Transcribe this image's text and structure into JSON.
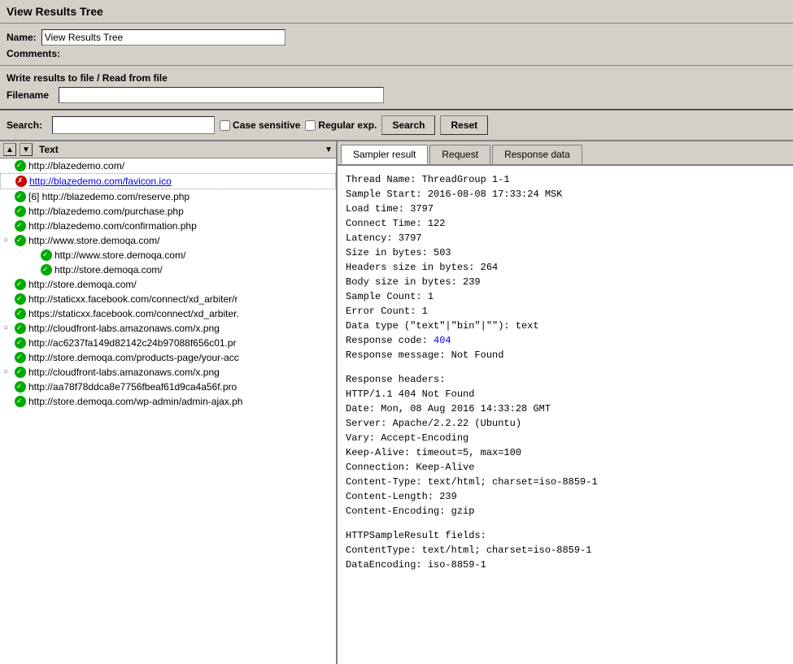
{
  "window": {
    "title": "View Results Tree"
  },
  "name_row": {
    "label": "Name:",
    "value": "View Results Tree"
  },
  "comments_row": {
    "label": "Comments:"
  },
  "write_section": {
    "header": "Write results to file / Read from file",
    "filename_label": "Filename"
  },
  "search": {
    "label": "Search:",
    "placeholder": "",
    "case_sensitive_label": "Case sensitive",
    "regular_exp_label": "Regular exp.",
    "search_button": "Search",
    "reset_button": "Reset"
  },
  "left_panel": {
    "column_header": "Text"
  },
  "tabs": {
    "sampler_result": "Sampler result",
    "request": "Request",
    "response_data": "Response data"
  },
  "tree_items": [
    {
      "id": 1,
      "indent": 0,
      "icon": "green",
      "url": "http://blazedemo.com/",
      "has_expand": false
    },
    {
      "id": 2,
      "indent": 0,
      "icon": "red",
      "url": "http://blazedemo.com/favicon.ico",
      "has_expand": false,
      "selected": true,
      "error": true
    },
    {
      "id": 3,
      "indent": 0,
      "icon": "green",
      "url": "[6] http://blazedemo.com/reserve.php",
      "has_expand": false
    },
    {
      "id": 4,
      "indent": 0,
      "icon": "green",
      "url": "http://blazedemo.com/purchase.php",
      "has_expand": false
    },
    {
      "id": 5,
      "indent": 0,
      "icon": "green",
      "url": "http://blazedemo.com/confirmation.php",
      "has_expand": false
    },
    {
      "id": 6,
      "indent": 0,
      "icon": "green",
      "url": "http://www.store.demoqa.com/",
      "has_expand": true,
      "expanded": true
    },
    {
      "id": 7,
      "indent": 1,
      "icon": "green",
      "url": "http://www.store.demoqa.com/",
      "has_expand": false
    },
    {
      "id": 8,
      "indent": 1,
      "icon": "green",
      "url": "http://store.demoqa.com/",
      "has_expand": false
    },
    {
      "id": 9,
      "indent": 0,
      "icon": "green",
      "url": "http://store.demoqa.com/",
      "has_expand": false
    },
    {
      "id": 10,
      "indent": 0,
      "icon": "green",
      "url": "http://staticxx.facebook.com/connect/xd_arbiter/r",
      "has_expand": false
    },
    {
      "id": 11,
      "indent": 0,
      "icon": "green",
      "url": "https://staticxx.facebook.com/connect/xd_arbiter.",
      "has_expand": false
    },
    {
      "id": 12,
      "indent": 0,
      "icon": "green",
      "url": "http://cloudfront-labs.amazonaws.com/x.png",
      "has_expand": true,
      "expanded": false
    },
    {
      "id": 13,
      "indent": 0,
      "icon": "green",
      "url": "http://ac6237fa149d82142c24b97088f656c01.pr",
      "has_expand": false
    },
    {
      "id": 14,
      "indent": 0,
      "icon": "green",
      "url": "http://store.demoqa.com/products-page/your-acc",
      "has_expand": false
    },
    {
      "id": 15,
      "indent": 0,
      "icon": "green",
      "url": "http://cloudfront-labs.amazonaws.com/x.png",
      "has_expand": true,
      "expanded": false
    },
    {
      "id": 16,
      "indent": 0,
      "icon": "green",
      "url": "http://aa78f78ddca8e7756fbeaf61d9ca4a56f.pro",
      "has_expand": false
    },
    {
      "id": 17,
      "indent": 0,
      "icon": "green",
      "url": "http://store.demoqa.com/wp-admin/admin-ajax.ph",
      "has_expand": false
    }
  ],
  "sampler_result": {
    "thread_name": "Thread Name: ThreadGroup 1-1",
    "sample_start": "Sample Start: 2016-08-08 17:33:24 MSK",
    "load_time": "Load time: 3797",
    "connect_time": "Connect Time: 122",
    "latency": "Latency: 3797",
    "size_bytes": "Size in bytes: 503",
    "headers_size": "Headers size in bytes: 264",
    "body_size": "Body size in bytes: 239",
    "sample_count": "Sample Count: 1",
    "error_count": "Error Count: 1",
    "data_type": "Data type (\"text\"|\"bin\"|\"\"): text",
    "response_code_prefix": "Response code: ",
    "response_code_value": "404",
    "response_message": "Response message: Not Found",
    "response_headers_label": "Response headers:",
    "http_status": "HTTP/1.1 404 Not Found",
    "date_header": "Date: Mon, 08 Aug 2016 14:33:28 GMT",
    "server_header": "Server: Apache/2.2.22 (Ubuntu)",
    "vary_header": "Vary: Accept-Encoding",
    "keep_alive_header": "Keep-Alive: timeout=5, max=100",
    "connection_header": "Connection: Keep-Alive",
    "content_type_header": "Content-Type: text/html; charset=iso-8859-1",
    "content_length_header": "Content-Length: 239",
    "content_encoding_header": "Content-Encoding: gzip",
    "httpsample_label": "HTTPSampleResult fields:",
    "content_type_field": "ContentType: text/html; charset=iso-8859-1",
    "data_encoding_field": "DataEncoding: iso-8859-1"
  }
}
